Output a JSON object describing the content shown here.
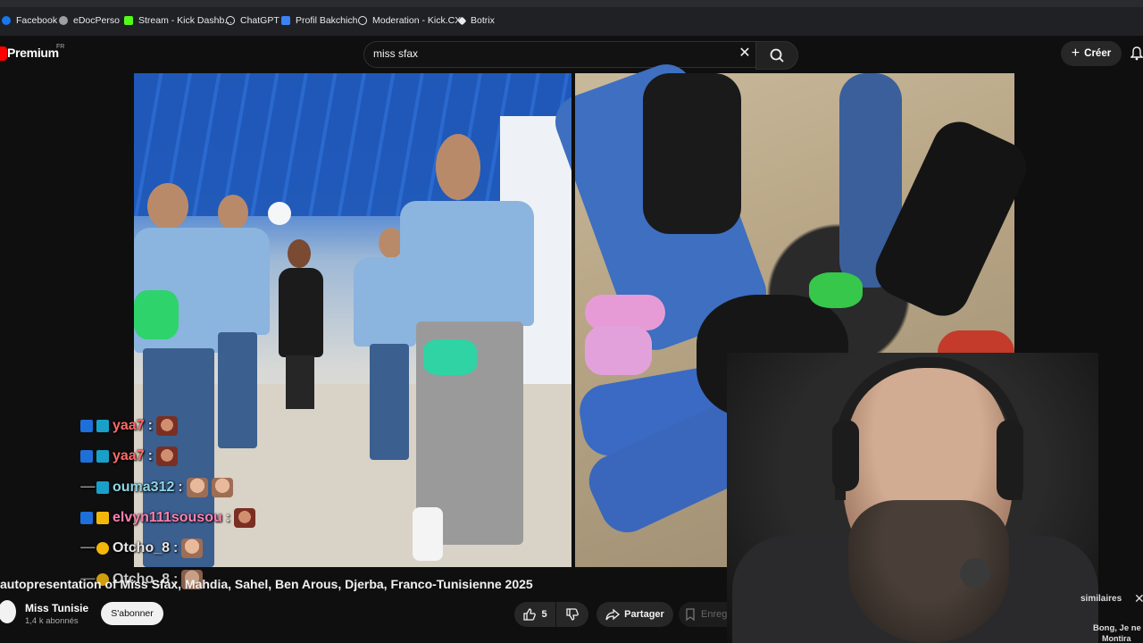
{
  "bookmarks": [
    {
      "label": "Facebook",
      "color": "#1877f2"
    },
    {
      "label": "eDocPerso",
      "color": "#9aa0a6"
    },
    {
      "label": "Stream - Kick Dashb...",
      "color": "#53fc18"
    },
    {
      "label": "ChatGPT",
      "color": "#e8eaed"
    },
    {
      "label": "Profil Bakchich",
      "color": "#3b82f6"
    },
    {
      "label": "Moderation - Kick.CX",
      "color": "#e8eaed"
    },
    {
      "label": "Botrix",
      "color": "#e8eaed"
    }
  ],
  "header": {
    "logo_text": "Premium",
    "logo_region": "FR",
    "search_value": "miss sfax",
    "create_label": "Créer"
  },
  "chat": [
    {
      "user": "yaa7",
      "sep": ":",
      "color": "#ff6a6a"
    },
    {
      "user": "yaa7",
      "sep": ":",
      "color": "#ff6a6a"
    },
    {
      "user": "ouma312",
      "sep": ":",
      "color": "#8fd6e6"
    },
    {
      "user": "elvyn111sousou",
      "sep": ":",
      "color": "#ff80b0"
    },
    {
      "user": "Otcho_8",
      "sep": ":",
      "color": "#e6e6e6"
    },
    {
      "user": "Otcho_8",
      "sep": ":",
      "color": "#e6e6e6"
    }
  ],
  "video": {
    "title": "autopresentation of Miss Sfax, Mahdia, Sahel, Ben Arous, Djerba, Franco-Tunisienne 2025",
    "channel": "Miss Tunisie",
    "subscribers": "1,4 k abonnés",
    "subscribe_label": "S'abonner",
    "likes": "5",
    "share_label": "Partager",
    "save_label": "Enregistrer"
  },
  "sidebar_peek": {
    "similar_label": "similaires",
    "next_line1": "Bong, Je ne",
    "next_line2": "Montira"
  },
  "colors": {
    "brand_red": "#ff0000",
    "accent_blue": "#1f58b8"
  }
}
